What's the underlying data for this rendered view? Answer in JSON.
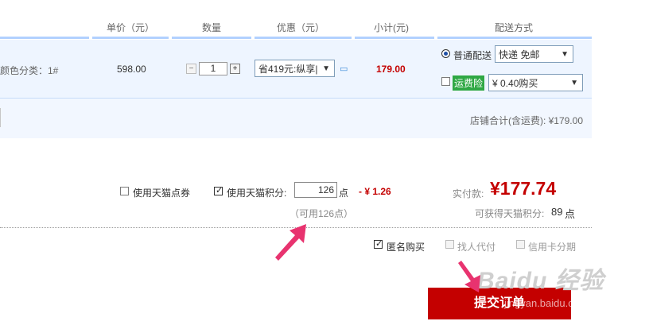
{
  "header": {
    "unit_price": "单价（元）",
    "quantity": "数量",
    "discount": "优惠（元）",
    "subtotal": "小计(元)",
    "shipping": "配送方式"
  },
  "item": {
    "spec_partial": "颜色分类：1#",
    "unit_price": "598.00",
    "qty": "1",
    "qty_minus": "−",
    "qty_plus": "+",
    "discount_select": "省419元:纵享|",
    "subtotal": "179.00",
    "normal_delivery_label": "普通配送",
    "delivery_select": "快递 免邮",
    "freight_insurance_label": "运费险",
    "insurance_select": "¥ 0.40购买"
  },
  "shop_total": "店铺合计(含运费): ¥179.00",
  "points": {
    "coupon_label": "使用天猫点券",
    "points_label": "使用天猫积分:",
    "points_input": "126",
    "points_unit": "点",
    "points_deduct": "- ¥ 1.26",
    "available_hint": "（可用126点）"
  },
  "summary": {
    "paid_label": "实付款:",
    "paid_amount": "¥177.74",
    "earn_label": "可获得天猫积分:",
    "earn_value": "89",
    "earn_unit": "点"
  },
  "options": {
    "anonymous": "匿名购买",
    "proxy_pay": "找人代付",
    "installment": "信用卡分期"
  },
  "submit_label": "提交订单",
  "watermark": "Baidu 经验",
  "watermark_url": "jingyan.baidu.com",
  "colors": {
    "accent_red": "#c40000",
    "arrow_pink": "#e8336f",
    "header_line": "#b2d1ff"
  }
}
